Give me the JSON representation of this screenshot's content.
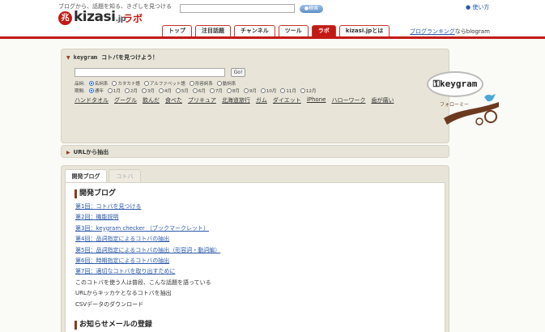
{
  "header": {
    "tagline": "ブログから、話題を知る、きざしを見つける",
    "logo_mark": "兆",
    "logo_text": "kizasi",
    "logo_suffix": ".jp",
    "logo_labo": "ラボ",
    "search_button": "検索",
    "help_link": "使い方",
    "tabs": [
      {
        "label": "トップ"
      },
      {
        "label": "注目話題"
      },
      {
        "label": "チャンネル"
      },
      {
        "label": "ツール"
      },
      {
        "label": "ラボ"
      },
      {
        "label": "kizasi.jpとは"
      }
    ],
    "ranking_link": "ブログランキング",
    "ranking_suffix": "ならblogram"
  },
  "kotoba": {
    "logo": "keygram",
    "title": "コトバを見つけよう！",
    "go_button": "Go!",
    "pos_label": "品詞:",
    "pos_options": [
      "名詞系",
      "カタカナ語",
      "アルファベット語",
      "形容詞系",
      "動詞系"
    ],
    "period_label": "期間:",
    "period_options": [
      "通年",
      "1月",
      "2月",
      "3月",
      "4月",
      "5月",
      "6月",
      "7月",
      "8月",
      "9月",
      "10月",
      "11月",
      "12月"
    ],
    "keywords": [
      "ハンドタオル",
      "グーグル",
      "飲んだ",
      "食べた",
      "プリキュア",
      "北海道旅行",
      "ガム",
      "ダイエット",
      "iPhone",
      "ハローワーク",
      "歯が痛い"
    ]
  },
  "mascot": {
    "badge": "keygram",
    "follow": "フォローミー"
  },
  "url_panel": {
    "title": "URLから抽出"
  },
  "blog_panel": {
    "tab_blog": "開発ブログ",
    "tab_kotoba": "コトバ",
    "heading": "開発ブログ",
    "items": [
      {
        "text": "第1回：コトバを見つける",
        "link": true
      },
      {
        "text": "第2回：機能説明",
        "link": true
      },
      {
        "text": "第3回：keygram checker （ブックマークレット）",
        "link": true
      },
      {
        "text": "第4回：品詞指定によるコトバの抽出",
        "link": true
      },
      {
        "text": "第5回：品詞指定によるコトバの抽出（形容詞・動詞編）",
        "link": true
      },
      {
        "text": "第6回：時期指定によるコトバの抽出",
        "link": true
      },
      {
        "text": "第7回：適切なコトバを取り出すために",
        "link": true
      },
      {
        "text": "このコトバを使う人は普段、こんな話題を語っている",
        "link": false
      },
      {
        "text": "URLからキッカケとなるコトバを抽出",
        "link": false
      },
      {
        "text": "CSVデータのダウンロード",
        "link": false
      }
    ],
    "mail_heading": "お知らせメールの登録"
  },
  "colors": {
    "brand_red": "#c21a14",
    "panel_bg": "#e8e5d8",
    "link_blue": "#2b58a8",
    "accent_brown": "#8a3b1c"
  }
}
